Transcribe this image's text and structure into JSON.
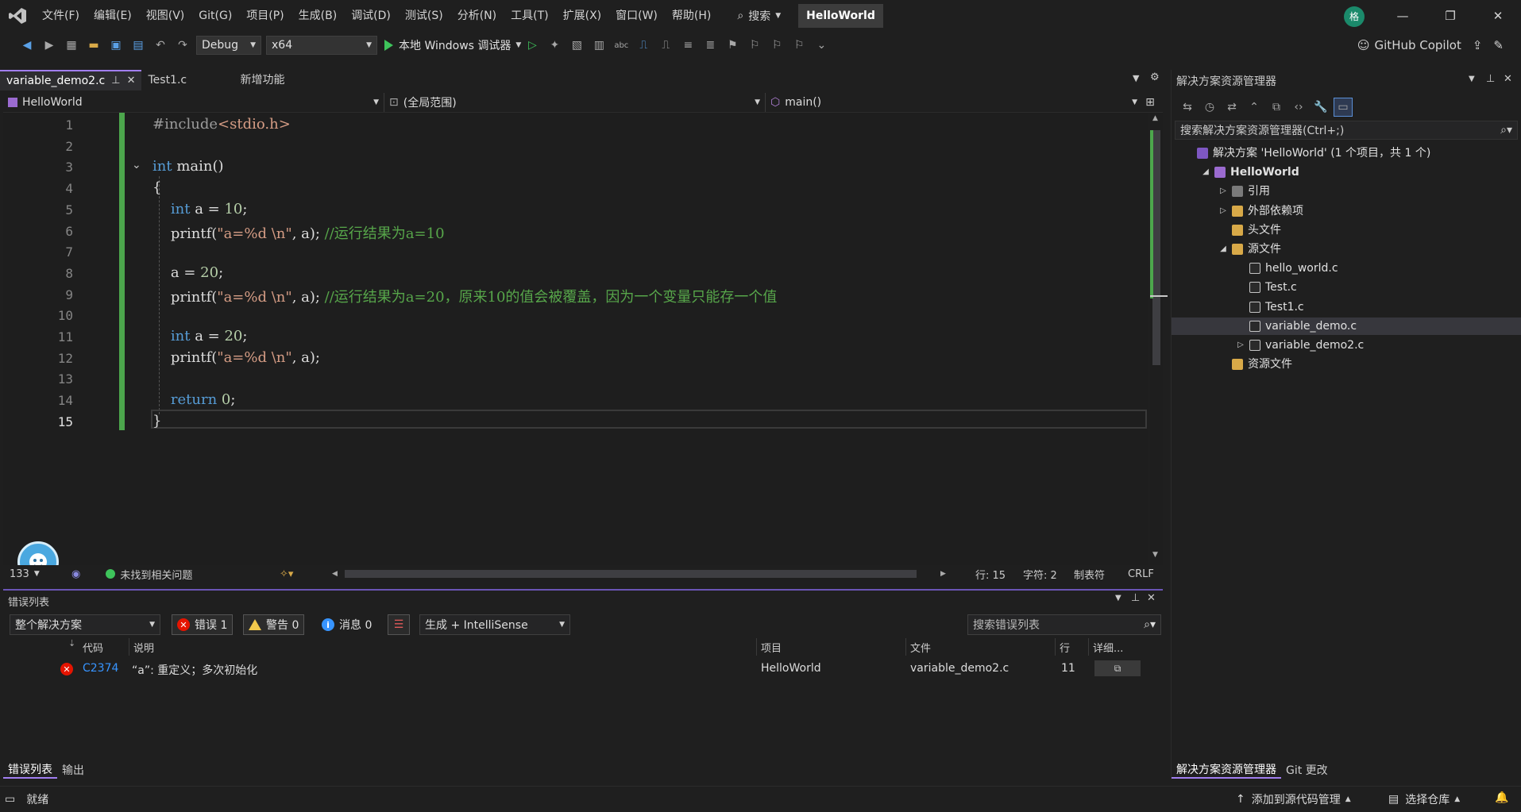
{
  "menu": {
    "items": [
      "文件(F)",
      "编辑(E)",
      "视图(V)",
      "Git(G)",
      "项目(P)",
      "生成(B)",
      "调试(D)",
      "测试(S)",
      "分析(N)",
      "工具(T)",
      "扩展(X)",
      "窗口(W)",
      "帮助(H)"
    ],
    "search_label": "搜索",
    "project_name": "HelloWorld",
    "avatar_initial": "格"
  },
  "toolbar": {
    "config": "Debug",
    "platform": "x64",
    "run_label": "本地 Windows 调试器",
    "copilot_label": "GitHub Copilot"
  },
  "tabs": [
    {
      "label": "variable_demo2.c",
      "active": true
    },
    {
      "label": "Test1.c",
      "active": false
    },
    {
      "label": "新增功能",
      "active": false
    }
  ],
  "navbar": {
    "project": "HelloWorld",
    "scope": "(全局范围)",
    "member": "main()"
  },
  "editor": {
    "line_numbers": [
      "1",
      "2",
      "3",
      "4",
      "5",
      "6",
      "7",
      "8",
      "9",
      "10",
      "11",
      "12",
      "13",
      "14",
      "15"
    ],
    "current_line": "15",
    "lines": [
      {
        "n": 1,
        "tokens": [
          [
            "pp",
            "#include"
          ],
          [
            "s",
            "<stdio.h>"
          ]
        ]
      },
      {
        "n": 2,
        "tokens": []
      },
      {
        "n": 3,
        "tokens": [
          [
            "k",
            "int"
          ],
          [
            "p",
            " main()"
          ]
        ]
      },
      {
        "n": 4,
        "tokens": [
          [
            "p",
            "{"
          ]
        ]
      },
      {
        "n": 5,
        "tokens": [
          [
            "p",
            "    "
          ],
          [
            "k",
            "int"
          ],
          [
            "p",
            " a = "
          ],
          [
            "n",
            "10"
          ],
          [
            "p",
            ";"
          ]
        ]
      },
      {
        "n": 6,
        "tokens": [
          [
            "p",
            "    "
          ],
          [
            "p",
            "printf("
          ],
          [
            "s",
            "\"a=%d \\n\""
          ],
          [
            "p",
            ", a); "
          ],
          [
            "c",
            "//运行结果为a=10"
          ]
        ]
      },
      {
        "n": 7,
        "tokens": []
      },
      {
        "n": 8,
        "tokens": [
          [
            "p",
            "    a = "
          ],
          [
            "n",
            "20"
          ],
          [
            "p",
            ";"
          ]
        ]
      },
      {
        "n": 9,
        "tokens": [
          [
            "p",
            "    "
          ],
          [
            "p",
            "printf("
          ],
          [
            "s",
            "\"a=%d \\n\""
          ],
          [
            "p",
            ", a); "
          ],
          [
            "c",
            "//运行结果为a=20，原来10的值会被覆盖，因为一个变量只能存一个值"
          ]
        ]
      },
      {
        "n": 10,
        "tokens": []
      },
      {
        "n": 11,
        "tokens": [
          [
            "p",
            "    "
          ],
          [
            "k",
            "int"
          ],
          [
            "p",
            " a = "
          ],
          [
            "n",
            "20"
          ],
          [
            "p",
            ";"
          ]
        ]
      },
      {
        "n": 12,
        "tokens": [
          [
            "p",
            "    "
          ],
          [
            "p",
            "printf("
          ],
          [
            "s",
            "\"a=%d \\n\""
          ],
          [
            "p",
            ", a);"
          ]
        ]
      },
      {
        "n": 13,
        "tokens": []
      },
      {
        "n": 14,
        "tokens": [
          [
            "p",
            "    "
          ],
          [
            "k",
            "return"
          ],
          [
            "p",
            " "
          ],
          [
            "n",
            "0"
          ],
          [
            "p",
            ";"
          ]
        ]
      },
      {
        "n": 15,
        "tokens": [
          [
            "p",
            "}"
          ]
        ]
      }
    ]
  },
  "editor_status": {
    "zoom": "133",
    "issues": "未找到相关问题",
    "line": "行: 15",
    "char": "字符: 2",
    "tab_mode": "制表符",
    "eol": "CRLF"
  },
  "error_list": {
    "title": "错误列表",
    "scope": "整个解决方案",
    "errors_label": "错误 1",
    "warnings_label": "警告 0",
    "messages_label": "消息 0",
    "source": "生成 + IntelliSense",
    "search_placeholder": "搜索错误列表",
    "columns": {
      "code": "代码",
      "desc": "说明",
      "project": "项目",
      "file": "文件",
      "line": "行",
      "details": "详细..."
    },
    "rows": [
      {
        "code": "C2374",
        "desc": "“a”: 重定义；多次初始化",
        "project": "HelloWorld",
        "file": "variable_demo2.c",
        "line": "11"
      }
    ]
  },
  "bottom_tabs": [
    "错误列表",
    "输出"
  ],
  "solution": {
    "title": "解决方案资源管理器",
    "search_placeholder": "搜索解决方案资源管理器(Ctrl+;)",
    "tree": [
      {
        "label": "解决方案 'HelloWorld' (1 个项目，共 1 个)",
        "level": 0,
        "icon": "sol",
        "exp": ""
      },
      {
        "label": "HelloWorld",
        "level": 1,
        "icon": "proj",
        "exp": "open",
        "bold": true
      },
      {
        "label": "引用",
        "level": 2,
        "icon": "ref",
        "exp": "closed"
      },
      {
        "label": "外部依赖项",
        "level": 2,
        "icon": "folder",
        "exp": "closed"
      },
      {
        "label": "头文件",
        "level": 2,
        "icon": "folder",
        "exp": ""
      },
      {
        "label": "源文件",
        "level": 2,
        "icon": "folder",
        "exp": "open"
      },
      {
        "label": "hello_world.c",
        "level": 3,
        "icon": "file",
        "exp": ""
      },
      {
        "label": "Test.c",
        "level": 3,
        "icon": "file",
        "exp": ""
      },
      {
        "label": "Test1.c",
        "level": 3,
        "icon": "file",
        "exp": ""
      },
      {
        "label": "variable_demo.c",
        "level": 3,
        "icon": "file",
        "exp": "",
        "selected": true
      },
      {
        "label": "variable_demo2.c",
        "level": 3,
        "icon": "file",
        "exp": "closed"
      },
      {
        "label": "资源文件",
        "level": 2,
        "icon": "folder",
        "exp": ""
      }
    ],
    "bottom_tabs": [
      "解决方案资源管理器",
      "Git 更改"
    ]
  },
  "statusbar": {
    "ready": "就绪",
    "add_source": "添加到源代码管理",
    "select_repo": "选择仓库"
  }
}
